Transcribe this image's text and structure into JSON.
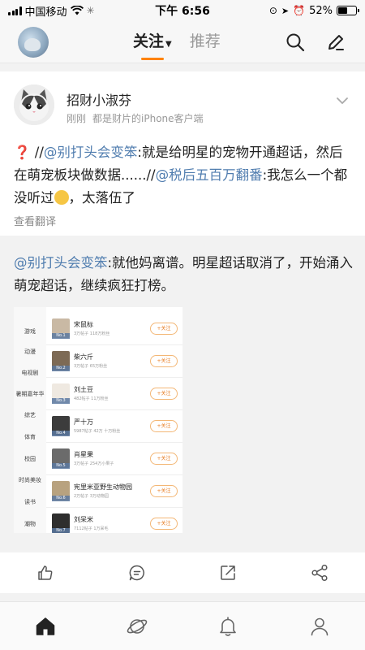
{
  "status_bar": {
    "carrier": "中国移动",
    "time": "下午 6:56",
    "battery_percent": "52%",
    "battery_level": 0.52
  },
  "header": {
    "tab_follow": "关注",
    "tab_recommend": "推荐"
  },
  "post": {
    "author": "招财小淑芬",
    "time": "刚刚",
    "source": "都是财片的iPhone客户端",
    "mark": "❓",
    "seg1": " //",
    "mention1": "@别打头会变笨",
    "seg2": ":就是给明星的宠物开通超话，然后在萌宠板块做数据......//",
    "mention2": "@税后五百万翻番",
    "seg3": ":我怎么一个都没听过",
    "seg4": "，太落伍了",
    "translate": "查看翻译"
  },
  "repost": {
    "mention": "@别打头会变笨",
    "text": ":就他妈离谱。明星超话取消了，开始涌入萌宠超话，继续疯狂打榜。",
    "image": {
      "categories": [
        "游戏",
        "动漫",
        "电视剧",
        "暑期嘉年华",
        "综艺",
        "体育",
        "校园",
        "时尚美妆",
        "读书",
        "潮物"
      ],
      "follow_label": "+关注",
      "rows": [
        {
          "no": "No.1",
          "name": "宋鼠标",
          "sub": "3万帖子 118万粉丝"
        },
        {
          "no": "No.2",
          "name": "柴六斤",
          "sub": "3万帖子 65万粉丝"
        },
        {
          "no": "No.3",
          "name": "刘土豆",
          "sub": "482帖子 11万粉丝"
        },
        {
          "no": "No.4",
          "name": "严十万",
          "sub": "5987帖子 42万 十万粉丝"
        },
        {
          "no": "No.5",
          "name": "肖星果",
          "sub": "3万帖子 254万小果子"
        },
        {
          "no": "No.6",
          "name": "宪里米亚野生动物园",
          "sub": "2万帖子 3万动物园"
        },
        {
          "no": "No.7",
          "name": "刘呆米",
          "sub": "7112帖子 1万呆毛"
        }
      ]
    }
  },
  "icons": {
    "like": "thumbs-up-icon",
    "comment": "comment-icon",
    "repost": "share-out-icon",
    "share": "share-nodes-icon",
    "home": "home-icon",
    "discover": "planet-icon",
    "notify": "bell-icon",
    "profile": "person-icon"
  },
  "colors": {
    "accent": "#ff8200",
    "link": "#507daf"
  }
}
